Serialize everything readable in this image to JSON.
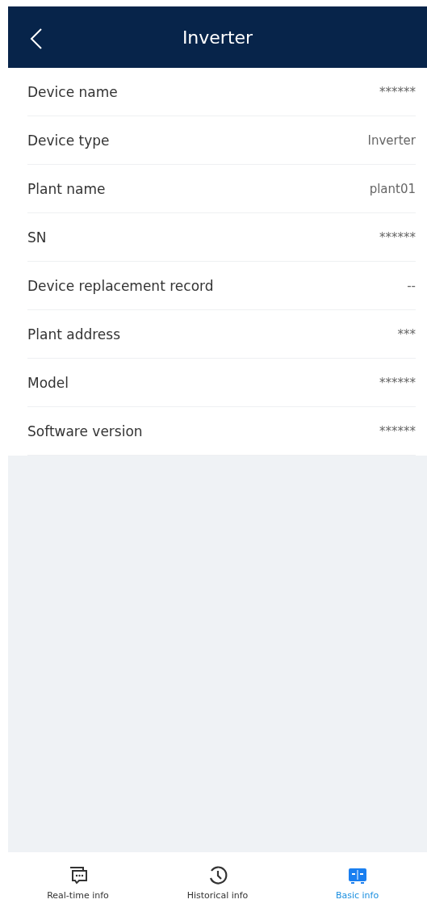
{
  "header": {
    "title": "Inverter"
  },
  "rows": [
    {
      "label": "Device name",
      "value": "******"
    },
    {
      "label": "Device type",
      "value": "Inverter"
    },
    {
      "label": "Plant name",
      "value": "plant01"
    },
    {
      "label": "SN",
      "value": "******"
    },
    {
      "label": "Device replacement record",
      "value": "--"
    },
    {
      "label": "Plant address",
      "value": "***"
    },
    {
      "label": "Model",
      "value": "******"
    },
    {
      "label": "Software version",
      "value": "******"
    }
  ],
  "tabs": [
    {
      "label": "Real-time info",
      "selected": false
    },
    {
      "label": "Historical info",
      "selected": false
    },
    {
      "label": "Basic info",
      "selected": true
    }
  ]
}
